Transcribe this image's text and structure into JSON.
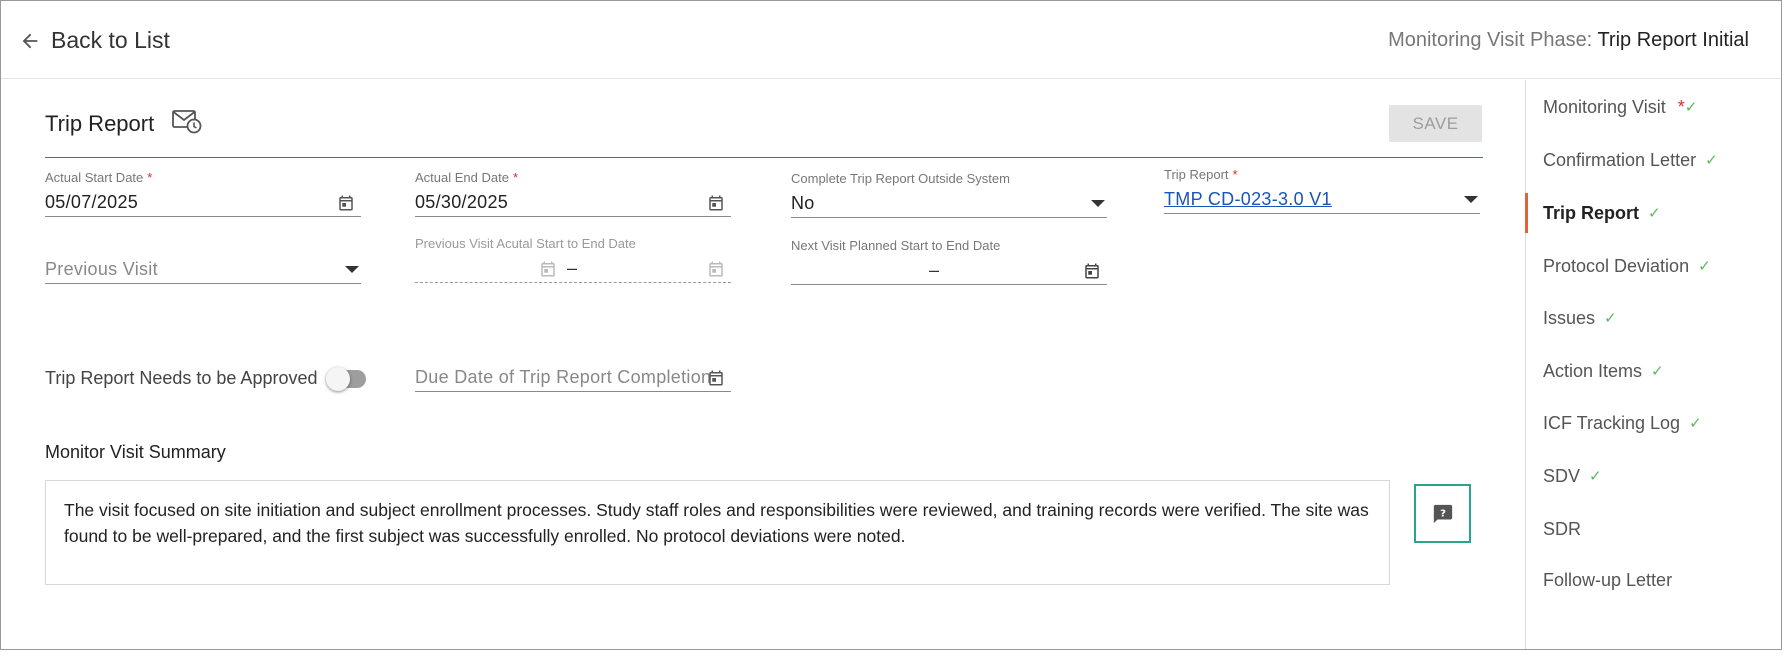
{
  "header": {
    "back_label": "Back to List",
    "phase_label": "Monitoring Visit Phase:",
    "phase_value": "Trip Report Initial"
  },
  "section": {
    "title": "Trip Report",
    "save_label": "SAVE"
  },
  "fields": {
    "actual_start": {
      "label": "Actual Start Date",
      "value": "05/07/2025"
    },
    "actual_end": {
      "label": "Actual End Date",
      "value": "05/30/2025"
    },
    "outside_system": {
      "label": "Complete Trip Report Outside System",
      "value": "No"
    },
    "trip_report": {
      "label": "Trip Report",
      "value": "TMP CD-023-3.0 V1"
    },
    "previous_visit": {
      "placeholder": "Previous Visit"
    },
    "prev_dates": {
      "label": "Previous Visit Acutal Start to End Date",
      "separator": "–"
    },
    "next_dates": {
      "label": "Next Visit Planned Start to End Date",
      "separator": "–"
    },
    "needs_approval": {
      "label": "Trip Report Needs to be Approved",
      "checked": false
    },
    "due_date": {
      "placeholder": "Due Date of Trip Report Completion"
    }
  },
  "required_marker": "*",
  "summary": {
    "label": "Monitor Visit Summary",
    "text": "The visit focused on site initiation and subject enrollment processes. Study staff roles and responsibilities were reviewed, and training records were verified. The site was found to be well-prepared, and the first subject was successfully enrolled. No protocol deviations were noted.",
    "help_icon": "help-comment-icon"
  },
  "sidenav": {
    "check_glyph": "✓",
    "items": [
      {
        "label": "Monitoring Visit",
        "required": true,
        "checked": true,
        "active": false
      },
      {
        "label": "Confirmation Letter",
        "checked": true,
        "active": false
      },
      {
        "label": "Trip Report",
        "checked": true,
        "active": true
      },
      {
        "label": "Protocol Deviation",
        "checked": true,
        "active": false
      },
      {
        "label": "Issues",
        "checked": true,
        "active": false
      },
      {
        "label": "Action Items",
        "checked": true,
        "active": false
      },
      {
        "label": "ICF Tracking Log",
        "checked": true,
        "active": false
      },
      {
        "label": "SDV",
        "checked": true,
        "active": false
      },
      {
        "label": "SDR",
        "checked": false,
        "active": false
      },
      {
        "label": "Follow-up Letter",
        "checked": false,
        "active": false
      }
    ]
  },
  "colors": {
    "accent_active": "#e0633a",
    "check": "#5cb85c",
    "required": "#d32f2f",
    "link": "#1a55b8",
    "help_border": "#2aa58a"
  }
}
